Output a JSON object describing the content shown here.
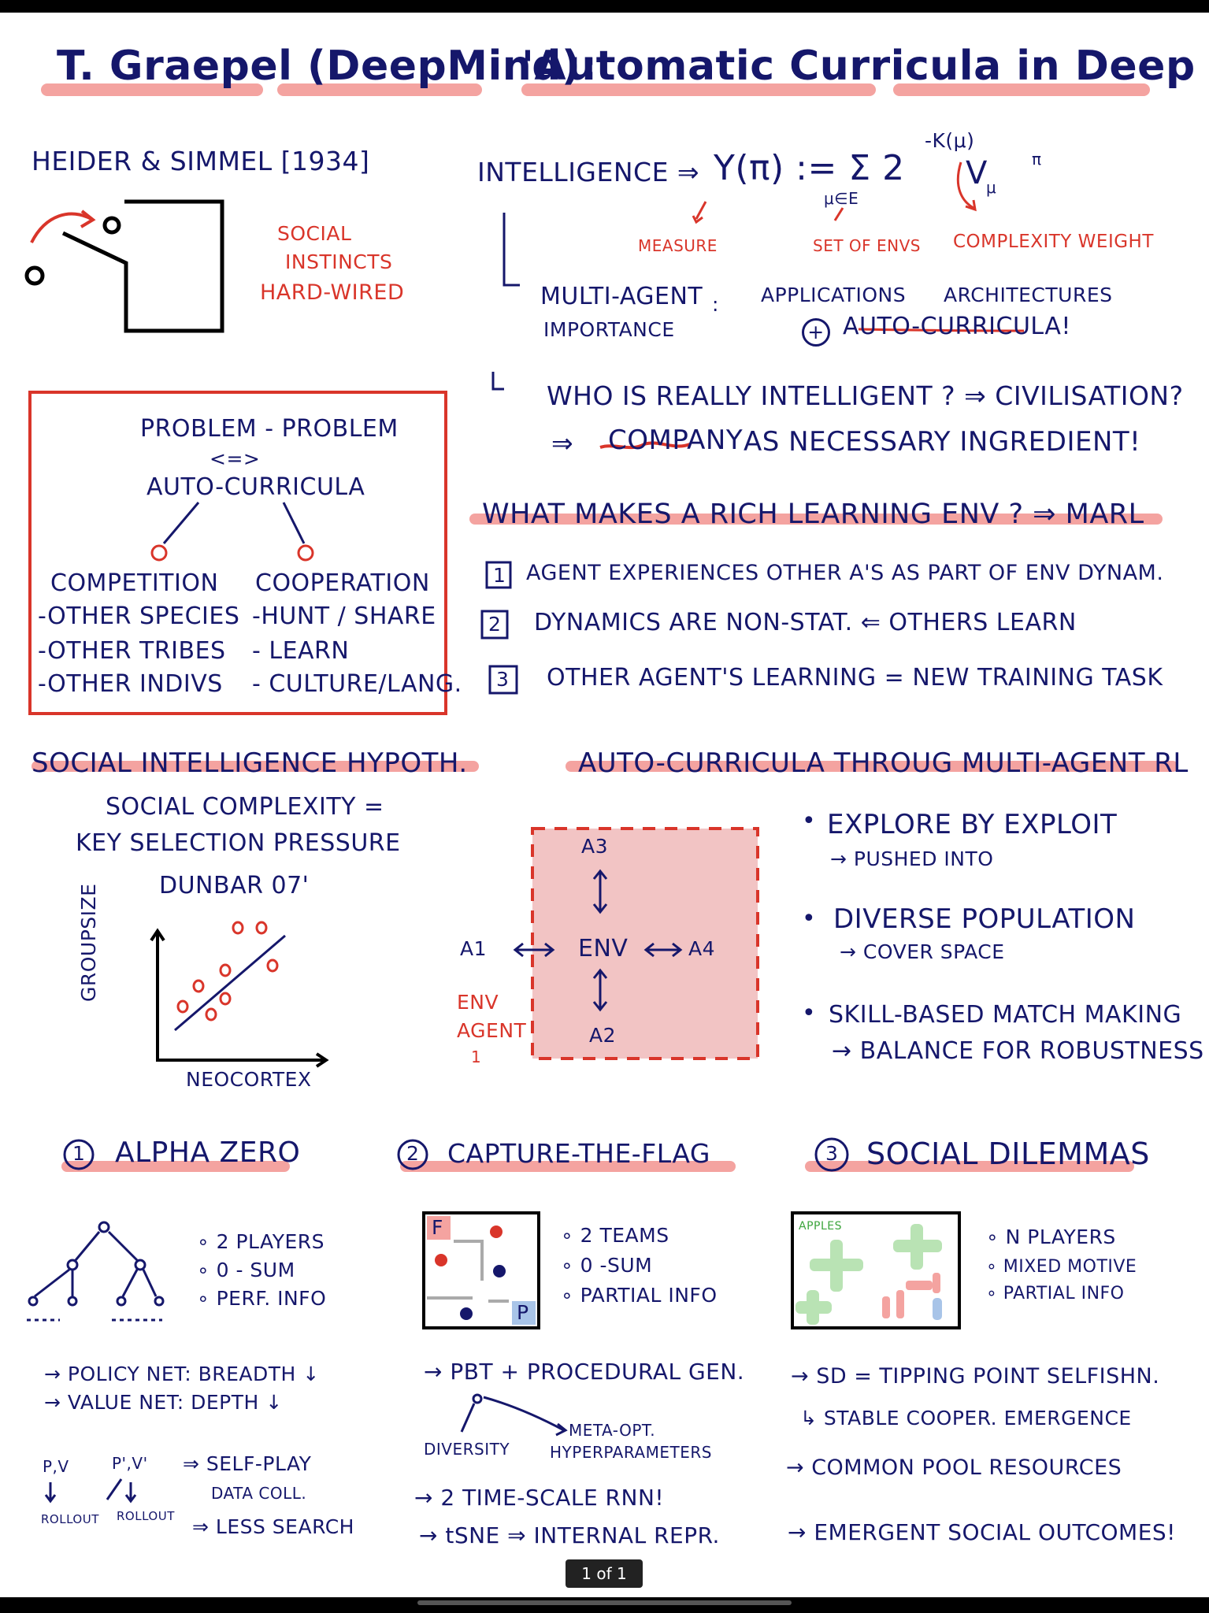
{
  "title": {
    "speaker": "T. Graepel (DeepMind):",
    "talk": "'Automatic Curricula in Deep MARL'"
  },
  "heider": {
    "heading": "HEIDER & SIMMEL [1934]",
    "notes": [
      "SOCIAL",
      "INSTINCTS",
      "HARD-WIRED"
    ]
  },
  "intelligence": {
    "lhs": "INTELLIGENCE ⇒",
    "formula": "Υ(π) := Σ 2",
    "subscript": "μ∈E",
    "exponent": "-K(μ)",
    "value_term": "V",
    "value_sub": "μ",
    "value_sup": "π",
    "labels": [
      "MEASURE",
      "SET OF ENVS",
      "COMPLEXITY WEIGHT"
    ],
    "multi_agent": "MULTI-AGENT",
    "importance": "IMPORTANCE",
    "colon": ":",
    "applications": "APPLICATIONS",
    "architectures": "ARCHITECTURES",
    "plus": "+",
    "auto_curricula": "AUTO-CURRICULA!",
    "who_line": "WHO IS REALLY INTELLIGENT ? ⇒ CIVILISATION?",
    "company_arrow": "⇒",
    "company_word": "COMPANY",
    "company_rest": "AS NECESSARY INGREDIENT!"
  },
  "problem_box": {
    "line1": "PROBLEM - PROBLEM",
    "line2": "<=>",
    "line3": "AUTO-CURRICULA",
    "competition": {
      "title": "COMPETITION",
      "items": [
        "-OTHER SPECIES",
        "-OTHER TRIBES",
        "-OTHER INDIVS"
      ]
    },
    "cooperation": {
      "title": "COOPERATION",
      "items": [
        "-HUNT / SHARE",
        "- LEARN",
        "- CULTURE/LANG."
      ]
    }
  },
  "rich_env": {
    "heading": "WHAT MAKES A RICH LEARNING ENV ? ⇒ MARL",
    "items": [
      {
        "num": "1",
        "text": "AGENT EXPERIENCES OTHER A'S AS PART OF ENV DYNAM."
      },
      {
        "num": "2",
        "text": "DYNAMICS ARE NON-STAT. ⇐ OTHERS LEARN"
      },
      {
        "num": "3",
        "text": "OTHER AGENT'S LEARNING = NEW TRAINING TASK"
      }
    ]
  },
  "social_hypothesis": {
    "heading": "SOCIAL INTELLIGENCE HYPOTH.",
    "line1": "SOCIAL COMPLEXITY =",
    "line2": "KEY SELECTION PRESSURE",
    "line3": "DUNBAR 07'",
    "y_label": "GROUPSIZE",
    "x_label": "NEOCORTEX"
  },
  "auto_curricula_rl": {
    "heading": "AUTO-CURRICULA THROUG MULTI-AGENT RL",
    "env": "ENV",
    "agents": [
      "A1",
      "A2",
      "A3",
      "A4"
    ],
    "env_agent_label": [
      "ENV",
      "AGENT",
      "1"
    ],
    "bullets": [
      {
        "title": "EXPLORE BY EXPLOIT",
        "sub": "→ PUSHED INTO"
      },
      {
        "title": "DIVERSE POPULATION",
        "sub": "→ COVER SPACE"
      },
      {
        "title": "SKILL-BASED MATCH MAKING",
        "sub": "→ BALANCE FOR ROBUSTNESS"
      }
    ]
  },
  "alphazero": {
    "num": "1",
    "heading": "ALPHA ZERO",
    "bullets": [
      "2 PLAYERS",
      "0 - SUM",
      "PERF. INFO"
    ],
    "notes": [
      "→ POLICY NET: BREADTH ↓",
      "→ VALUE NET: DEPTH ↓"
    ],
    "pv": [
      "P,V",
      "P',V'"
    ],
    "rollout": [
      "ROLLOUT",
      "ROLLOUT"
    ],
    "selfplay": [
      "⇒ SELF-PLAY",
      "DATA COLL.",
      "⇒ LESS SEARCH"
    ]
  },
  "ctf": {
    "num": "2",
    "heading": "CAPTURE-THE-FLAG",
    "flag_a": "F",
    "flag_b": "P",
    "bullets": [
      "2 TEAMS",
      "0 -SUM",
      "PARTIAL INFO"
    ],
    "pbt": "→ PBT + PROCEDURAL GEN.",
    "diversity": "DIVERSITY",
    "meta_opt": "META-OPT.",
    "hyperparams": "HYPERPARAMETERS",
    "notes": [
      "→ 2 TIME-SCALE RNN!",
      "→ tSNE ⇒ INTERNAL REPR."
    ]
  },
  "social_dilemmas": {
    "num": "3",
    "heading": "SOCIAL DILEMMAS",
    "apples": "APPLES",
    "bullets": [
      "N PLAYERS",
      "MIXED MOTIVE",
      "PARTIAL INFO"
    ],
    "notes": [
      "→ SD = TIPPING POINT SELFISHN.",
      "↳ STABLE COOPER. EMERGENCE",
      "→ COMMON POOL RESOURCES",
      "→ EMERGENT SOCIAL OUTCOMES!"
    ]
  },
  "viewer": {
    "page_counter": "1 of 1"
  },
  "colors": {
    "ink": "#15176b",
    "red": "#d9352a",
    "highlight": "#f4a3a0",
    "env_fill": "#f2c4c4",
    "green": "#3ca43c"
  }
}
